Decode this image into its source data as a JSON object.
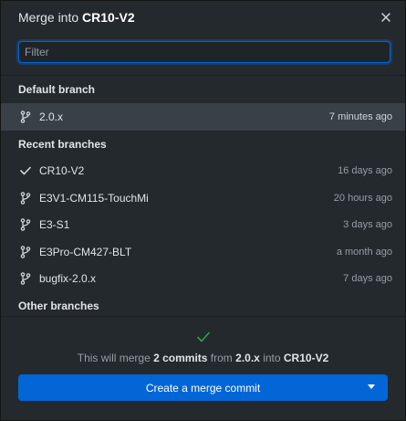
{
  "header": {
    "title_prefix": "Merge into",
    "title_branch": "CR10-V2"
  },
  "filter": {
    "placeholder": "Filter",
    "value": ""
  },
  "sections": {
    "default_label": "Default branch",
    "recent_label": "Recent branches",
    "other_label": "Other branches"
  },
  "default_branch": {
    "name": "2.0.x",
    "time": "7 minutes ago"
  },
  "recent_branches": [
    {
      "name": "CR10-V2",
      "time": "16 days ago",
      "icon": "check-icon"
    },
    {
      "name": "E3V1-CM115-TouchMi",
      "time": "20 hours ago",
      "icon": "branch-icon"
    },
    {
      "name": "E3-S1",
      "time": "3 days ago",
      "icon": "branch-icon"
    },
    {
      "name": "E3Pro-CM427-BLT",
      "time": "a month ago",
      "icon": "branch-icon"
    },
    {
      "name": "bugfix-2.0.x",
      "time": "7 days ago",
      "icon": "branch-icon"
    }
  ],
  "footer": {
    "text_prefix": "This will merge",
    "commit_count": "2 commits",
    "text_from": "from",
    "source_branch": "2.0.x",
    "text_into": "into",
    "target_branch": "CR10-V2",
    "button_label": "Create a merge commit"
  },
  "colors": {
    "accent": "#0366d6",
    "success": "#28a745",
    "selected_row": "#3a4047"
  }
}
